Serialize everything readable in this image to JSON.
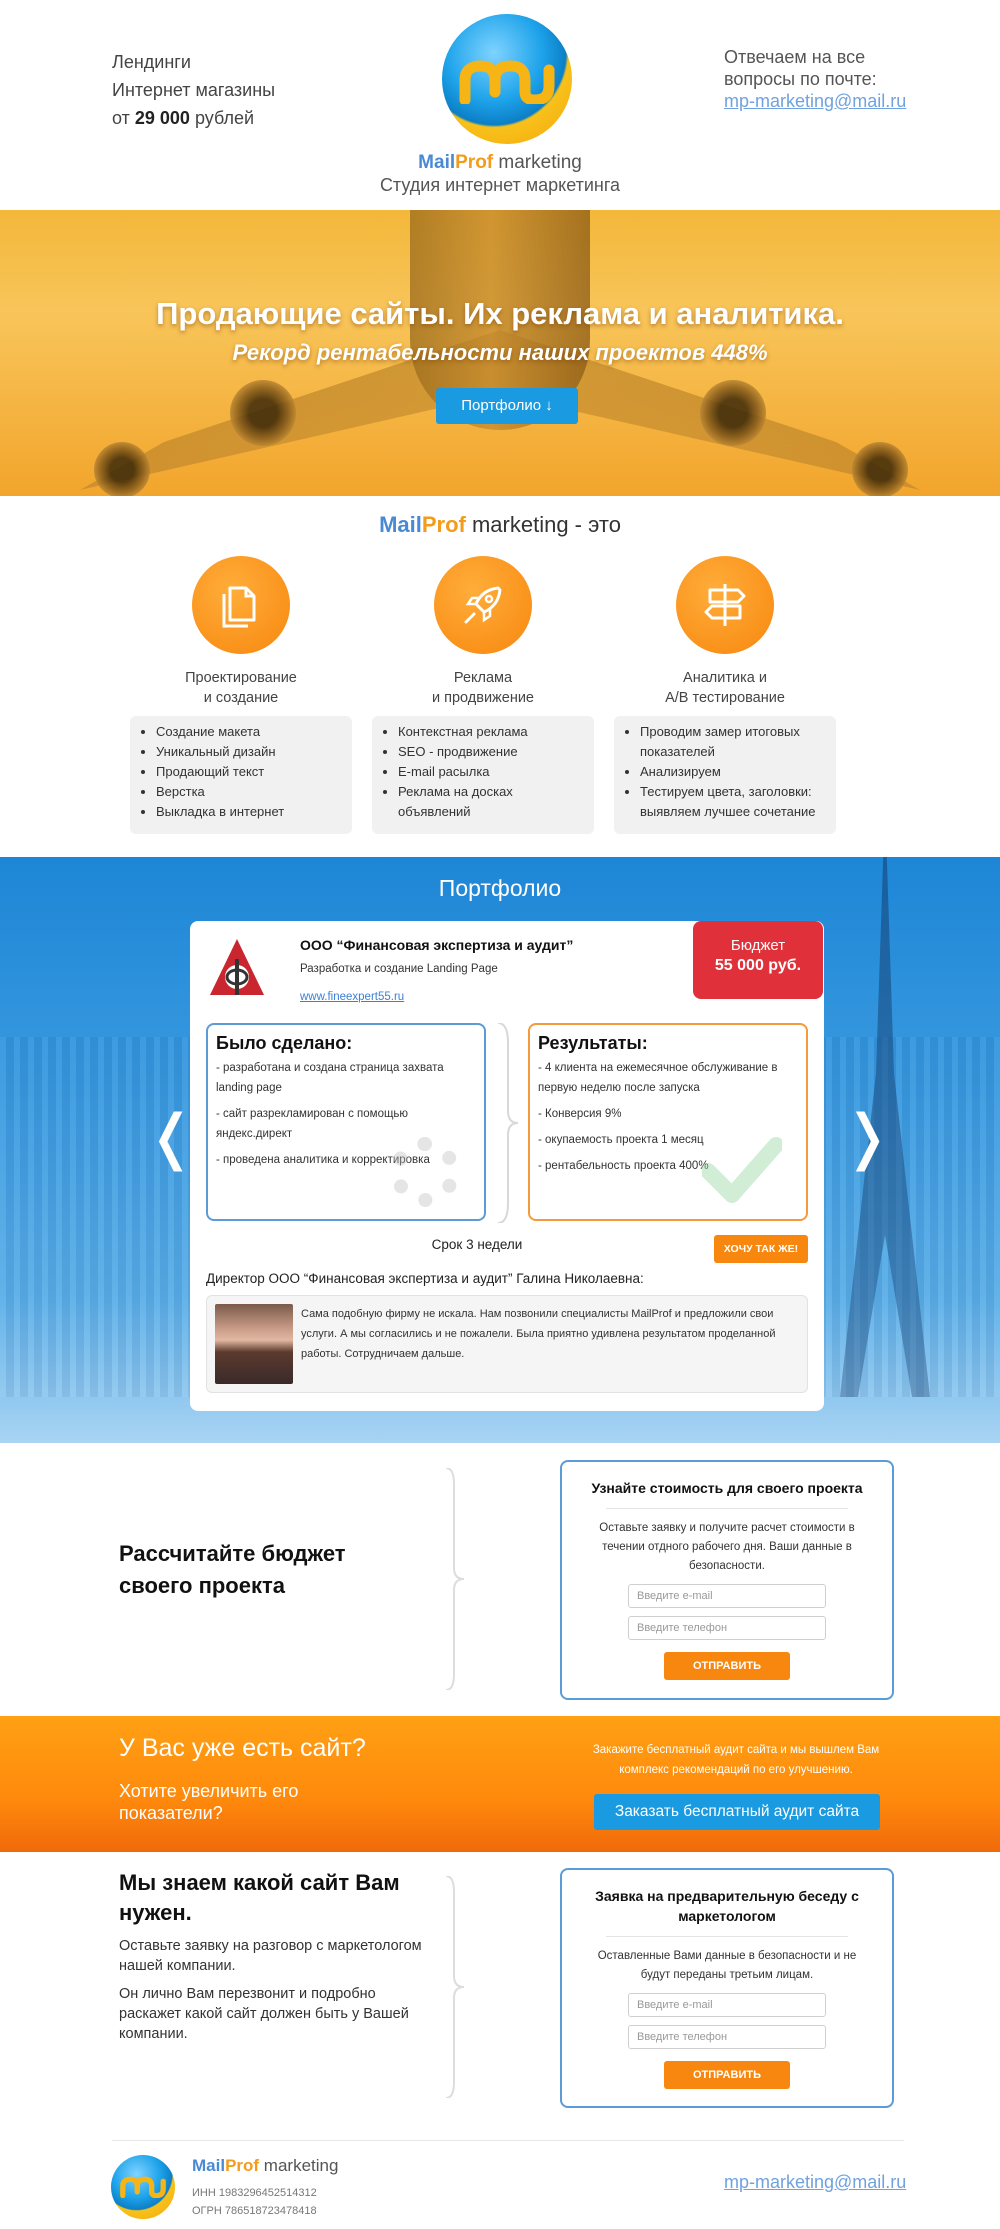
{
  "header": {
    "left_line1": "Лендинги",
    "left_line2": "Интернет магазины",
    "left_prefix": "от ",
    "left_price": "29 000",
    "left_suffix": " рублей",
    "right_text": "Отвечаем на все вопросы по почте:",
    "email": "mp-marketing@mail.ru",
    "brand_mail": "Mail",
    "brand_prof": "Prof",
    "brand_marketing": " marketing",
    "studio": "Студия интернет маркетинга"
  },
  "hero": {
    "title": "Продающие сайты. Их реклама и аналитика.",
    "subtitle": "Рекорд рентабельности наших проектов 448%",
    "button": "Портфолио ↓"
  },
  "services": {
    "title_mail": "Mail",
    "title_prof": "Prof",
    "title_rest": " marketing - это",
    "items": [
      {
        "icon": "document-icon",
        "name_l1": "Проектирование",
        "name_l2": "и создание",
        "list": [
          "Создание макета",
          "Уникальный дизайн",
          "Продающий текст",
          "Верстка",
          "Выкладка в интернет"
        ]
      },
      {
        "icon": "rocket-icon",
        "name_l1": "Реклама",
        "name_l2": "и продвижение",
        "list": [
          "Контекстная реклама",
          "SEO - продвижение",
          "E-mail расылка",
          "Реклама на досках объявлений"
        ]
      },
      {
        "icon": "signpost-icon",
        "name_l1": "Аналитика и",
        "name_l2": "A/B тестирование",
        "list": [
          "Проводим замер итоговых показателей",
          "Анализируем",
          "Тестируем цвета, заголовки: выявляем лучшее сочетание"
        ]
      }
    ]
  },
  "portfolio": {
    "title": "Портфолио",
    "prev": "❬",
    "next": "❭",
    "company": "ООО “Финансовая экспертиза и аудит”",
    "project": "Разработка и создание Landing Page",
    "link": "www.fineexpert55.ru",
    "budget_label": "Бюджет",
    "budget_value": "55 000 руб.",
    "done_title": "Было сделано:",
    "done": [
      "- разработана и создана страница захвата landing page",
      "- сайт разрекламирован с помощью яндекс.директ",
      "- проведена аналитика и корректировка"
    ],
    "results_title": "Результаты:",
    "results": [
      "- 4 клиента на ежемесячное обслуживание в первую неделю после запуска",
      "- Конверсия 9%",
      "- окупаемость проекта 1 месяц",
      "- рентабельность проекта 400%"
    ],
    "term": "Срок 3 недели",
    "want_button": "ХОЧУ ТАК ЖЕ!",
    "director": "Директор ООО “Финансовая экспертиза и аудит” Галина Николаевна:",
    "review": "Сама подобную фирму не искала. Нам позвонили специалисты MailProf и предложили свои услуги. А мы согласились и не пожалели. Была приятно удивлена результатом проделанной работы. Сотрудничаем дальше."
  },
  "calc": {
    "heading": "Рассчитайте бюджет своего проекта",
    "form_title": "Узнайте стоимость для своего проекта",
    "form_text": "Оставьте заявку и получите расчет стоимости в течении отдного рабочего дня. Ваши данные в безопасности.",
    "email_placeholder": "Введите e-mail",
    "phone_placeholder": "Введите телефон",
    "send": "ОТПРАВИТЬ"
  },
  "audit": {
    "heading": "У Вас уже есть сайт?",
    "sub": "Хотите увеличить его показатели?",
    "text": "Закажите бесплатный аудит сайта и мы вышлем Вам комплекс рекомендаций по его улучшению.",
    "button": "Заказать бесплатный аудит сайта"
  },
  "know": {
    "heading": "Мы знаем какой сайт Вам нужен.",
    "p1": "Оставьте заявку на разговор с маркетологом нашей компании.",
    "p2": "Он лично Вам перезвонит и подробно раскажет какой сайт должен быть у Вашей компании.",
    "form_title": "Заявка на предварительную беседу с маркетологом",
    "form_text": "Оставленные Вами данные в безопасности и не будут переданы третьим лицам.",
    "email_placeholder": "Введите e-mail",
    "phone_placeholder": "Введите телефон",
    "send": "ОТПРАВИТЬ"
  },
  "footer": {
    "brand_mail": "Mail",
    "brand_prof": "Prof",
    "brand_marketing": " marketing",
    "inn": "ИНН 1983296452514312",
    "ogrn": "ОГРН 786518723478418",
    "email": "mp-marketing@mail.ru"
  },
  "colors": {
    "accent_orange": "#f7870e",
    "accent_blue": "#1a9ae0",
    "budget_red": "#e0313a"
  }
}
